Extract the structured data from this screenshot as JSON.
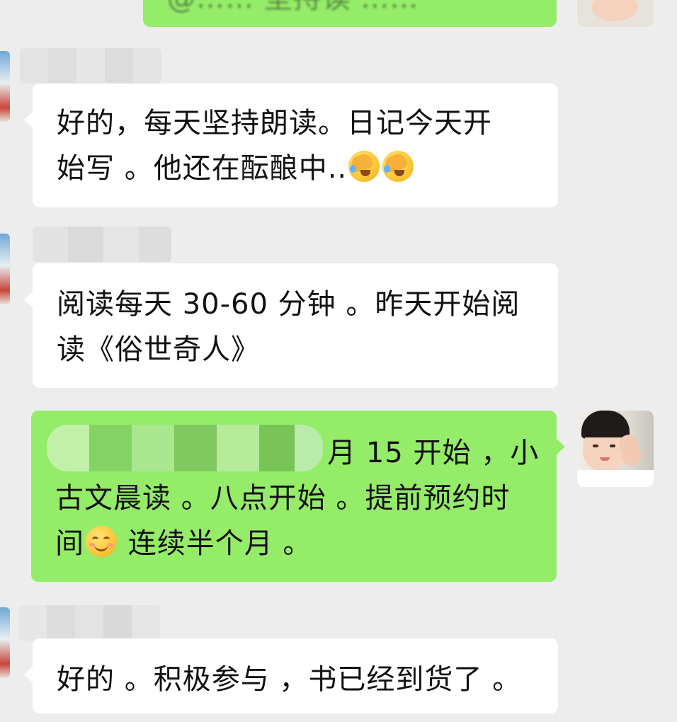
{
  "messages": [
    {
      "direction": "outgoing",
      "lines": [
        "@…… 坚持读 ……"
      ],
      "partially_visible": true
    },
    {
      "direction": "incoming",
      "lines": [
        "好的，每天坚持朗读。日记今天开",
        "始写 。他还在酝酿中.."
      ],
      "emoji": [
        "face-palm-emoji",
        "face-palm-emoji"
      ]
    },
    {
      "direction": "incoming",
      "lines": [
        "阅读每天 30-60 分钟 。昨天开始阅",
        "读《俗世奇人》"
      ]
    },
    {
      "direction": "outgoing",
      "lines": [
        "8 月 15 开始 ，小",
        "古文晨读 。八点开始 。提前预约时",
        "间",
        "连续半个月 。"
      ],
      "emoji": [
        "smile-emoji"
      ]
    },
    {
      "direction": "incoming",
      "lines": [
        "好的 。积极参与 ，书已经到货了 。"
      ]
    }
  ],
  "colors": {
    "background": "#ededed",
    "incoming_bubble": "#ffffff",
    "outgoing_bubble": "#95ec69",
    "text": "#111111"
  }
}
